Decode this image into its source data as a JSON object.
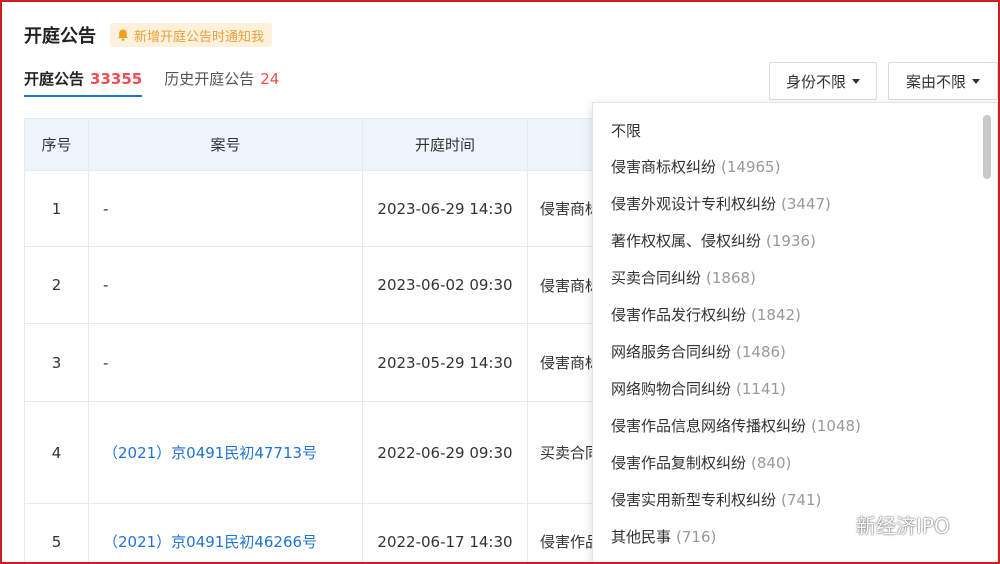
{
  "header": {
    "title": "开庭公告",
    "notify_label": "新增开庭公告时通知我"
  },
  "tabs": [
    {
      "label": "开庭公告",
      "count": "33355"
    },
    {
      "label": "历史开庭公告",
      "count": "24"
    }
  ],
  "filters": {
    "identity_label": "身份不限",
    "cause_label": "案由不限"
  },
  "table": {
    "headers": [
      "序号",
      "案号",
      "开庭时间",
      ""
    ],
    "rows": [
      {
        "seq": "1",
        "case_no": "-",
        "time": "2023-06-29 14:30",
        "cause": "侵害商标"
      },
      {
        "seq": "2",
        "case_no": "-",
        "time": "2023-06-02 09:30",
        "cause": "侵害商标"
      },
      {
        "seq": "3",
        "case_no": "-",
        "time": "2023-05-29 14:30",
        "cause": "侵害商标"
      },
      {
        "seq": "4",
        "case_no": "（2021）京0491民初47713号",
        "time": "2022-06-29 09:30",
        "cause": "买卖合同"
      },
      {
        "seq": "5",
        "case_no": "（2021）京0491民初46266号",
        "time": "2022-06-17 14:30",
        "cause": "侵害作品"
      }
    ]
  },
  "dropdown": {
    "items": [
      {
        "label": "不限",
        "count": ""
      },
      {
        "label": "侵害商标权纠纷",
        "count": "(14965)"
      },
      {
        "label": "侵害外观设计专利权纠纷",
        "count": "(3447)"
      },
      {
        "label": "著作权权属、侵权纠纷",
        "count": "(1936)"
      },
      {
        "label": "买卖合同纠纷",
        "count": "(1868)"
      },
      {
        "label": "侵害作品发行权纠纷",
        "count": "(1842)"
      },
      {
        "label": "网络服务合同纠纷",
        "count": "(1486)"
      },
      {
        "label": "网络购物合同纠纷",
        "count": "(1141)"
      },
      {
        "label": "侵害作品信息网络传播权纠纷",
        "count": "(1048)"
      },
      {
        "label": "侵害作品复制权纠纷",
        "count": "(840)"
      },
      {
        "label": "侵害实用新型专利权纠纷",
        "count": "(741)"
      },
      {
        "label": "其他民事",
        "count": "(716)"
      }
    ]
  },
  "watermark": {
    "text": "新经济IPO"
  },
  "colors": {
    "accent": "#1f73d6",
    "count_red": "#ef4d56",
    "border_red": "#cc1f1f"
  }
}
